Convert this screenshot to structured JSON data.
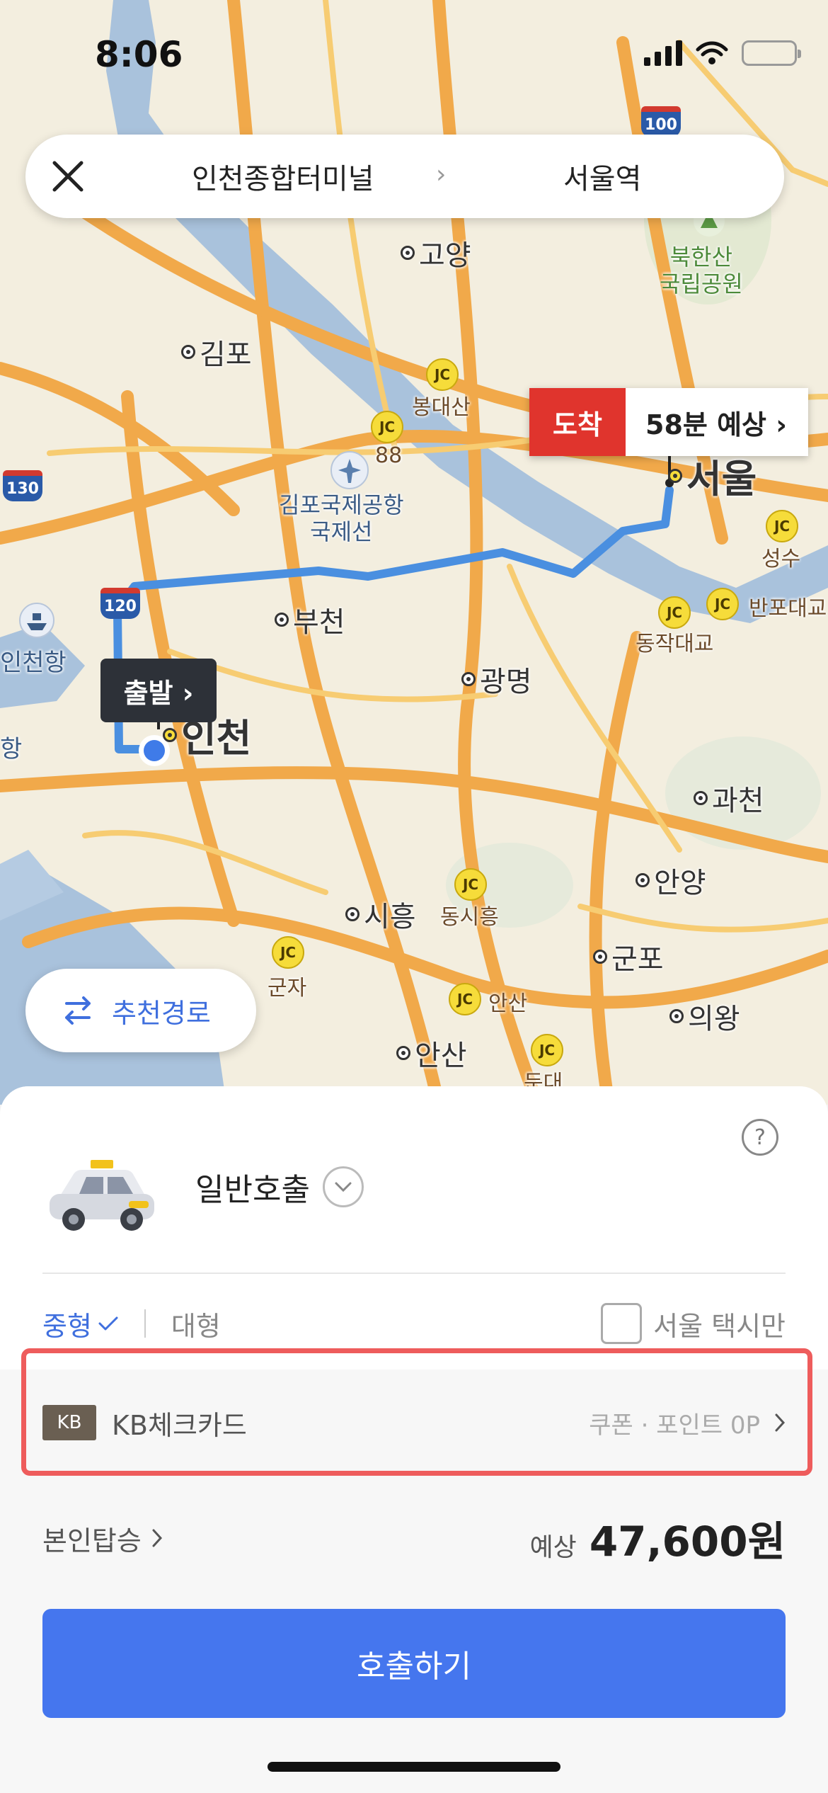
{
  "status_bar": {
    "time": "8:06"
  },
  "route": {
    "origin": "인천종합터미널",
    "separator": "›",
    "destination": "서울역"
  },
  "map": {
    "places": {
      "goyang": "고양",
      "gimpo": "김포",
      "bucheon": "부천",
      "gwangmyeong": "광명",
      "incheon": "인천",
      "seoul": "서울",
      "gwacheon": "과천",
      "anyang": "안양",
      "siheung": "시흥",
      "gunpo": "군포",
      "uiwang": "의왕",
      "ansan": "안산",
      "incheon_port": "인천항",
      "port2": "항",
      "bukhansan": "북한산\n국립공원",
      "airport": "김포국제공항\n국제선",
      "bongdaesan": "봉대산",
      "seongsu": "성수",
      "banpo": "반포대교",
      "dongjak": "동작대교",
      "dongsiheung": "동시흥",
      "gunja": "군자",
      "ansan_jc": "안산",
      "dundae": "둔대"
    },
    "road_numbers": {
      "r100": "100",
      "r130": "130",
      "r120": "120",
      "r88": "88"
    },
    "jc_label": "JC"
  },
  "markers": {
    "arrive_tag": "도착",
    "arrive_eta": "58분 예상 ›",
    "depart_label": "출발 ›"
  },
  "recommend_route": "추천경로",
  "sheet": {
    "help": "?",
    "call_type": "일반호출",
    "size_mid": "중형",
    "size_large": "대형",
    "seoul_only": "서울 택시만",
    "card_logo": "KB",
    "card_name": "KB체크카드",
    "coupon": "쿠폰 · 포인트 0P",
    "rider": "본인탑승",
    "fare_label": "예상",
    "fare_amount": "47,600원",
    "call_button": "호출하기"
  },
  "colors": {
    "accent": "#4576ee",
    "arrive": "#e0342d",
    "route_line": "#4a8fe0",
    "highlight": "#ec4a4a"
  }
}
